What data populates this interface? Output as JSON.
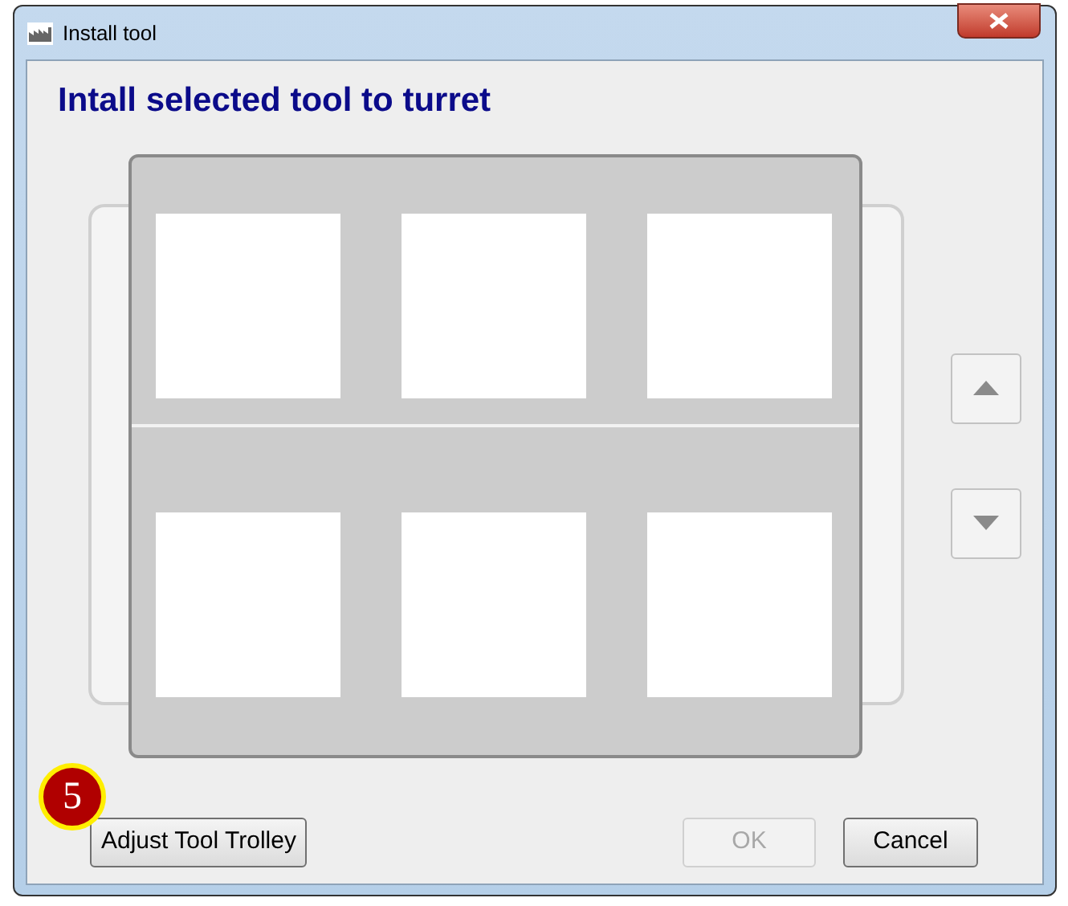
{
  "window": {
    "title": "Install tool"
  },
  "heading": "Intall selected tool to turret",
  "turret": {
    "rows": [
      {
        "slots": [
          {
            "kind": "empty"
          },
          {
            "kind": "empty"
          },
          {
            "kind": "empty"
          }
        ]
      },
      {
        "slots": [
          {
            "kind": "empty"
          },
          {
            "kind": "empty"
          },
          {
            "kind": "empty"
          }
        ]
      }
    ]
  },
  "scroll_buttons": [
    {
      "kind": "up"
    },
    {
      "kind": "down"
    }
  ],
  "step_badge": "5",
  "buttons": [
    {
      "label": "Adjust Tool Trolley",
      "disabled": false
    },
    {
      "label": "OK",
      "disabled": true
    },
    {
      "label": "Cancel",
      "disabled": false
    }
  ]
}
